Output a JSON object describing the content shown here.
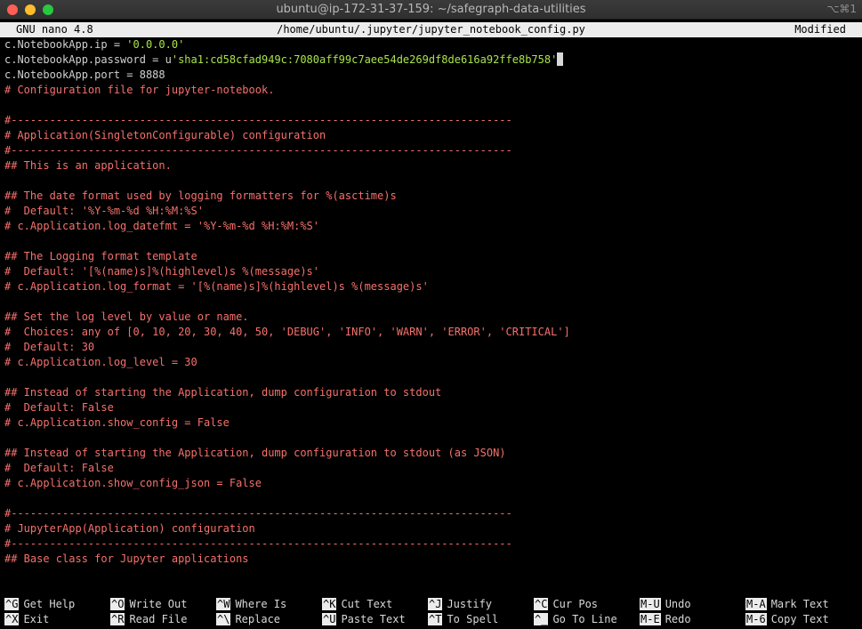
{
  "window": {
    "title": "ubuntu@ip-172-31-37-159: ~/safegraph-data-utilities",
    "shortcut": "⌥⌘1"
  },
  "nano": {
    "version": "GNU nano 4.8",
    "file_path": "/home/ubuntu/.jupyter/jupyter_notebook_config.py",
    "status": "Modified"
  },
  "lines": [
    {
      "segments": [
        {
          "t": "c.NotebookApp.ip = ",
          "c": "plain"
        },
        {
          "t": "'0.0.0.0'",
          "c": "string"
        }
      ]
    },
    {
      "segments": [
        {
          "t": "c.NotebookApp.password = u",
          "c": "plain"
        },
        {
          "t": "'sha1:cd58cfad949c:7080aff99c7aee54de269df8de616a92ffe8b758'",
          "c": "string"
        }
      ],
      "cursor": true
    },
    {
      "segments": [
        {
          "t": "c.NotebookApp.port = 8888",
          "c": "plain"
        }
      ]
    },
    {
      "segments": [
        {
          "t": "# Configuration file for jupyter-notebook.",
          "c": "comment"
        }
      ]
    },
    {
      "segments": []
    },
    {
      "segments": [
        {
          "t": "#------------------------------------------------------------------------------",
          "c": "comment"
        }
      ]
    },
    {
      "segments": [
        {
          "t": "# Application(SingletonConfigurable) configuration",
          "c": "comment"
        }
      ]
    },
    {
      "segments": [
        {
          "t": "#------------------------------------------------------------------------------",
          "c": "comment"
        }
      ]
    },
    {
      "segments": [
        {
          "t": "## This is an application.",
          "c": "comment"
        }
      ]
    },
    {
      "segments": []
    },
    {
      "segments": [
        {
          "t": "## The date format used by logging formatters for %(asctime)s",
          "c": "comment"
        }
      ]
    },
    {
      "segments": [
        {
          "t": "#  Default: '%Y-%m-%d %H:%M:%S'",
          "c": "comment"
        }
      ]
    },
    {
      "segments": [
        {
          "t": "# c.Application.log_datefmt = '%Y-%m-%d %H:%M:%S'",
          "c": "comment"
        }
      ]
    },
    {
      "segments": []
    },
    {
      "segments": [
        {
          "t": "## The Logging format template",
          "c": "comment"
        }
      ]
    },
    {
      "segments": [
        {
          "t": "#  Default: '[%(name)s]%(highlevel)s %(message)s'",
          "c": "comment"
        }
      ]
    },
    {
      "segments": [
        {
          "t": "# c.Application.log_format = '[%(name)s]%(highlevel)s %(message)s'",
          "c": "comment"
        }
      ]
    },
    {
      "segments": []
    },
    {
      "segments": [
        {
          "t": "## Set the log level by value or name.",
          "c": "comment"
        }
      ]
    },
    {
      "segments": [
        {
          "t": "#  Choices: any of [0, 10, 20, 30, 40, 50, 'DEBUG', 'INFO', 'WARN', 'ERROR', 'CRITICAL']",
          "c": "comment"
        }
      ]
    },
    {
      "segments": [
        {
          "t": "#  Default: 30",
          "c": "comment"
        }
      ]
    },
    {
      "segments": [
        {
          "t": "# c.Application.log_level = 30",
          "c": "comment"
        }
      ]
    },
    {
      "segments": []
    },
    {
      "segments": [
        {
          "t": "## Instead of starting the Application, dump configuration to stdout",
          "c": "comment"
        }
      ]
    },
    {
      "segments": [
        {
          "t": "#  Default: False",
          "c": "comment"
        }
      ]
    },
    {
      "segments": [
        {
          "t": "# c.Application.show_config = False",
          "c": "comment"
        }
      ]
    },
    {
      "segments": []
    },
    {
      "segments": [
        {
          "t": "## Instead of starting the Application, dump configuration to stdout (as JSON)",
          "c": "comment"
        }
      ]
    },
    {
      "segments": [
        {
          "t": "#  Default: False",
          "c": "comment"
        }
      ]
    },
    {
      "segments": [
        {
          "t": "# c.Application.show_config_json = False",
          "c": "comment"
        }
      ]
    },
    {
      "segments": []
    },
    {
      "segments": [
        {
          "t": "#------------------------------------------------------------------------------",
          "c": "comment"
        }
      ]
    },
    {
      "segments": [
        {
          "t": "# JupyterApp(Application) configuration",
          "c": "comment"
        }
      ]
    },
    {
      "segments": [
        {
          "t": "#------------------------------------------------------------------------------",
          "c": "comment"
        }
      ]
    },
    {
      "segments": [
        {
          "t": "## Base class for Jupyter applications",
          "c": "comment"
        }
      ]
    }
  ],
  "help_items": [
    {
      "key": "^G",
      "label": "Get Help"
    },
    {
      "key": "^X",
      "label": "Exit"
    },
    {
      "key": "^O",
      "label": "Write Out"
    },
    {
      "key": "^R",
      "label": "Read File"
    },
    {
      "key": "^W",
      "label": "Where Is"
    },
    {
      "key": "^\\",
      "label": "Replace"
    },
    {
      "key": "^K",
      "label": "Cut Text"
    },
    {
      "key": "^U",
      "label": "Paste Text"
    },
    {
      "key": "^J",
      "label": "Justify"
    },
    {
      "key": "^T",
      "label": "To Spell"
    },
    {
      "key": "^C",
      "label": "Cur Pos"
    },
    {
      "key": "^_",
      "label": "Go To Line"
    },
    {
      "key": "M-U",
      "label": "Undo"
    },
    {
      "key": "M-E",
      "label": "Redo"
    },
    {
      "key": "M-A",
      "label": "Mark Text"
    },
    {
      "key": "M-6",
      "label": "Copy Text"
    }
  ],
  "colors": {
    "comment": "#f5716c",
    "string": "#a9e34b",
    "header_bg": "#ececec"
  }
}
